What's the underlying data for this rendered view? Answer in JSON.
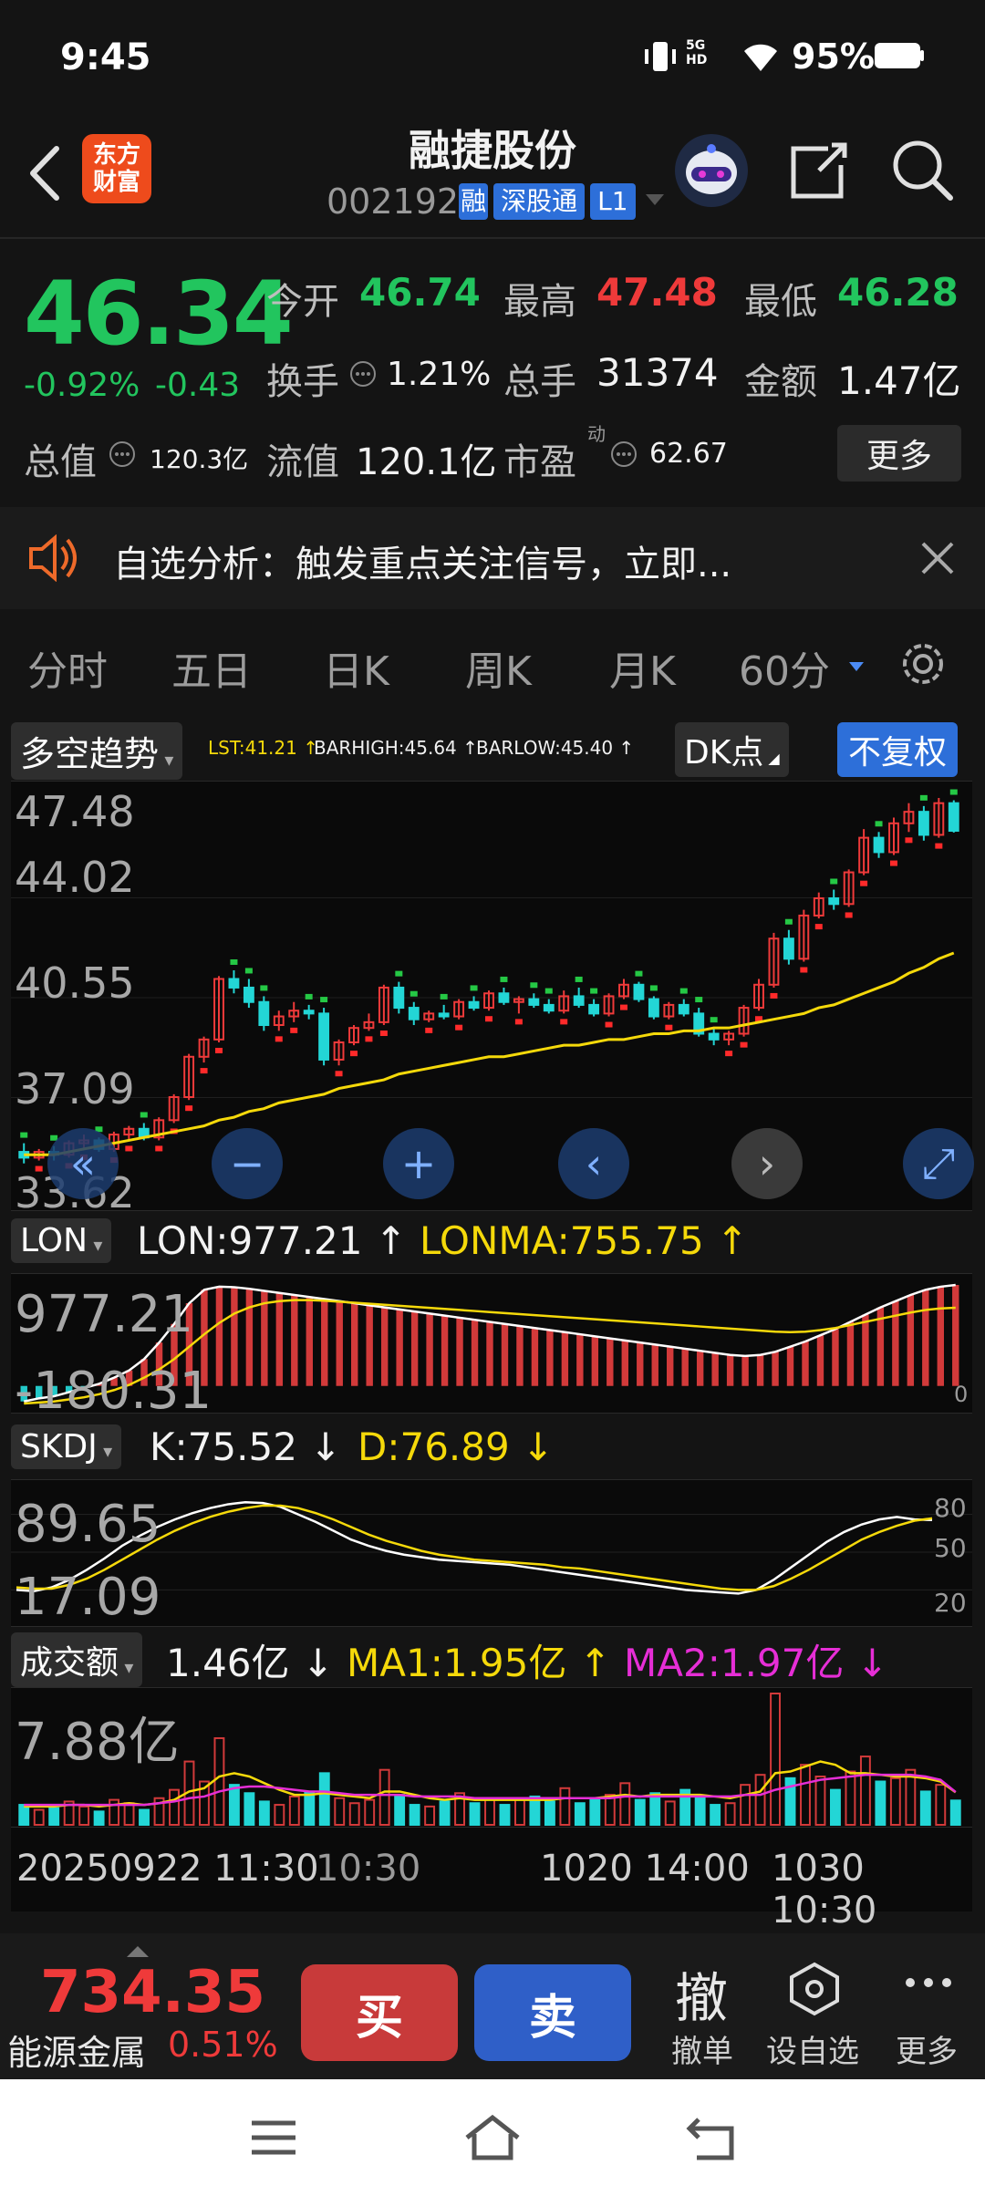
{
  "status_bar": {
    "time": "9:45",
    "network": "5G HD",
    "battery": "95%"
  },
  "header": {
    "logo_line1": "东方",
    "logo_line2": "财富",
    "stock_name": "融捷股份",
    "stock_code": "002192",
    "code_tag": "融",
    "tags": [
      "深股通",
      "L1"
    ]
  },
  "quote": {
    "price": "46.34",
    "change_pct": "-0.92%",
    "change": "-0.43",
    "open_label": "今开",
    "open": "46.74",
    "high_label": "最高",
    "high": "47.48",
    "low_label": "最低",
    "low": "46.28",
    "turnover_label": "换手",
    "turnover": "1.21%",
    "volume_label": "总手",
    "volume": "31374",
    "amount_label": "金额",
    "amount": "1.47亿",
    "mktcap_label": "总值",
    "mktcap": "120.3亿",
    "float_label": "流值",
    "float_cap": "120.1亿",
    "pe_label": "市盈",
    "pe_sup": "动",
    "pe": "62.67",
    "more_label": "更多"
  },
  "alert": {
    "text": "自选分析：触发重点关注信号，立即..."
  },
  "tabs": [
    "分时",
    "五日",
    "日K",
    "周K",
    "月K",
    "60分"
  ],
  "main_chart": {
    "indicator": "多空趋势",
    "lst": "LST:41.21 ↑",
    "barhigh": "BARHIGH:45.64 ↑",
    "barlow": "BARLOW:45.40 ↑",
    "dk_label": "DK点",
    "fq_label": "不复权",
    "yticks": [
      "47.48",
      "44.02",
      "40.55",
      "37.09",
      "33.62"
    ]
  },
  "lon_panel": {
    "name": "LON",
    "lon": "LON:977.21 ↑",
    "lonma": "LONMA:755.75 ↑",
    "ytop": "977.21",
    "ybottom": "-180.31",
    "right_label": "0"
  },
  "skdj_panel": {
    "name": "SKDJ",
    "k": "K:75.52 ↓",
    "d": "D:76.89 ↓",
    "ytop": "89.65",
    "ybottom": "17.09",
    "r80": "80",
    "r50": "50",
    "r20": "20"
  },
  "vol_panel": {
    "name": "成交额",
    "val": "1.46亿 ↓",
    "ma1": "MA1:1.95亿 ↑",
    "ma2": "MA2:1.97亿 ↓",
    "ytop": "7.88亿"
  },
  "x_axis": {
    "left": "20250922 11:30",
    "left2": "10:30",
    "mid": "1020 14:00",
    "right": "1030 10:30"
  },
  "bottom_bar": {
    "index_value": "734.35",
    "index_name": "能源金属",
    "index_change": "0.51%",
    "buy": "买",
    "sell": "卖",
    "cancel_icon": "撤",
    "cancel": "撤单",
    "watch": "设自选",
    "more": "更多"
  },
  "chart_data": {
    "type": "candlestick",
    "ylim": [
      33.62,
      47.48
    ],
    "candles": [
      [
        35.2,
        35.5,
        34.8,
        35.0
      ],
      [
        35.0,
        35.3,
        34.9,
        35.2
      ],
      [
        35.2,
        35.4,
        34.9,
        35.1
      ],
      [
        35.1,
        35.6,
        35.0,
        35.5
      ],
      [
        35.5,
        35.8,
        35.3,
        35.6
      ],
      [
        35.6,
        35.7,
        35.2,
        35.3
      ],
      [
        35.3,
        35.9,
        35.2,
        35.8
      ],
      [
        35.8,
        36.1,
        35.6,
        36.0
      ],
      [
        36.0,
        36.2,
        35.6,
        35.7
      ],
      [
        35.7,
        36.4,
        35.6,
        36.3
      ],
      [
        36.3,
        37.2,
        36.2,
        37.1
      ],
      [
        37.1,
        38.6,
        37.0,
        38.5
      ],
      [
        38.5,
        39.2,
        38.3,
        39.1
      ],
      [
        39.1,
        41.3,
        39.0,
        41.2
      ],
      [
        41.2,
        41.5,
        40.7,
        40.9
      ],
      [
        40.9,
        41.2,
        40.2,
        40.4
      ],
      [
        40.4,
        40.6,
        39.4,
        39.6
      ],
      [
        39.6,
        40.1,
        39.4,
        39.9
      ],
      [
        39.9,
        40.4,
        39.7,
        40.1
      ],
      [
        40.1,
        40.3,
        39.8,
        40.0
      ],
      [
        40.0,
        40.2,
        38.2,
        38.4
      ],
      [
        38.4,
        39.1,
        38.2,
        39.0
      ],
      [
        39.0,
        39.6,
        38.9,
        39.5
      ],
      [
        39.5,
        40.0,
        39.4,
        39.7
      ],
      [
        39.7,
        41.0,
        39.6,
        40.9
      ],
      [
        40.9,
        41.1,
        40.0,
        40.2
      ],
      [
        40.2,
        40.4,
        39.6,
        39.8
      ],
      [
        39.8,
        40.1,
        39.7,
        40.0
      ],
      [
        40.0,
        40.3,
        39.8,
        39.9
      ],
      [
        39.9,
        40.5,
        39.8,
        40.4
      ],
      [
        40.4,
        40.6,
        40.1,
        40.2
      ],
      [
        40.2,
        40.8,
        40.1,
        40.7
      ],
      [
        40.7,
        40.9,
        40.3,
        40.4
      ],
      [
        40.4,
        40.6,
        40.0,
        40.5
      ],
      [
        40.5,
        40.7,
        40.2,
        40.3
      ],
      [
        40.3,
        40.5,
        40.0,
        40.1
      ],
      [
        40.1,
        40.8,
        40.0,
        40.6
      ],
      [
        40.6,
        40.9,
        40.2,
        40.3
      ],
      [
        40.3,
        40.5,
        39.9,
        40.0
      ],
      [
        40.0,
        40.7,
        39.9,
        40.6
      ],
      [
        40.6,
        41.2,
        40.5,
        41.0
      ],
      [
        41.0,
        41.1,
        40.4,
        40.5
      ],
      [
        40.5,
        40.6,
        39.8,
        39.9
      ],
      [
        39.9,
        40.4,
        39.8,
        40.3
      ],
      [
        40.3,
        40.5,
        39.9,
        40.0
      ],
      [
        40.0,
        40.2,
        39.2,
        39.3
      ],
      [
        39.3,
        39.5,
        38.9,
        39.1
      ],
      [
        39.1,
        39.4,
        38.9,
        39.3
      ],
      [
        39.3,
        40.3,
        39.2,
        40.2
      ],
      [
        40.2,
        41.2,
        40.1,
        41.0
      ],
      [
        41.0,
        42.8,
        40.9,
        42.6
      ],
      [
        42.6,
        42.9,
        41.7,
        41.9
      ],
      [
        41.9,
        43.6,
        41.8,
        43.4
      ],
      [
        43.4,
        44.2,
        43.3,
        44.0
      ],
      [
        44.0,
        44.3,
        43.6,
        43.8
      ],
      [
        43.8,
        45.0,
        43.7,
        44.9
      ],
      [
        44.9,
        46.4,
        44.8,
        46.1
      ],
      [
        46.1,
        46.3,
        45.4,
        45.6
      ],
      [
        45.6,
        46.8,
        45.5,
        46.6
      ],
      [
        46.6,
        47.3,
        46.3,
        47.0
      ],
      [
        47.0,
        47.2,
        46.0,
        46.2
      ],
      [
        46.2,
        47.48,
        46.1,
        47.3
      ],
      [
        47.3,
        47.4,
        46.28,
        46.34
      ]
    ],
    "ma": [
      35.1,
      35.1,
      35.1,
      35.2,
      35.3,
      35.4,
      35.5,
      35.6,
      35.7,
      35.8,
      35.9,
      36.0,
      36.1,
      36.3,
      36.4,
      36.6,
      36.7,
      36.9,
      37.0,
      37.1,
      37.2,
      37.4,
      37.5,
      37.6,
      37.7,
      37.9,
      38.0,
      38.1,
      38.2,
      38.3,
      38.4,
      38.5,
      38.5,
      38.6,
      38.7,
      38.8,
      38.9,
      38.9,
      39.0,
      39.1,
      39.1,
      39.2,
      39.3,
      39.3,
      39.4,
      39.4,
      39.5,
      39.5,
      39.6,
      39.7,
      39.8,
      39.9,
      40.0,
      40.2,
      40.3,
      40.5,
      40.7,
      40.9,
      41.1,
      41.4,
      41.6,
      41.9,
      42.1
    ],
    "lon": [
      -150,
      -120,
      -100,
      -60,
      -20,
      20,
      80,
      150,
      260,
      420,
      600,
      800,
      930,
      960,
      955,
      940,
      920,
      900,
      880,
      860,
      840,
      820,
      800,
      780,
      760,
      740,
      720,
      700,
      680,
      660,
      640,
      620,
      600,
      580,
      560,
      540,
      520,
      500,
      480,
      460,
      440,
      420,
      400,
      380,
      360,
      340,
      320,
      300,
      290,
      300,
      330,
      380,
      430,
      490,
      550,
      620,
      690,
      760,
      820,
      880,
      930,
      960,
      977
    ],
    "lonma": [
      -170,
      -160,
      -150,
      -130,
      -110,
      -80,
      -40,
      10,
      80,
      160,
      260,
      380,
      500,
      610,
      700,
      760,
      800,
      820,
      830,
      830,
      825,
      815,
      805,
      795,
      785,
      775,
      765,
      755,
      745,
      735,
      725,
      715,
      705,
      695,
      685,
      675,
      665,
      655,
      645,
      635,
      625,
      615,
      605,
      595,
      585,
      575,
      565,
      555,
      545,
      535,
      525,
      520,
      525,
      540,
      560,
      590,
      620,
      650,
      680,
      710,
      735,
      750,
      756
    ],
    "skdj_k": [
      20,
      19,
      22,
      28,
      36,
      45,
      55,
      63,
      70,
      76,
      81,
      85,
      88,
      89.65,
      89,
      86,
      80,
      74,
      67,
      60,
      55,
      51,
      48,
      46,
      44,
      43,
      42,
      41,
      40,
      38,
      36,
      34,
      32,
      30,
      28,
      26,
      24,
      22,
      20,
      19,
      18,
      17.09,
      20,
      28,
      38,
      48,
      58,
      66,
      72,
      76,
      78,
      76,
      75.52
    ],
    "skdj_d": [
      22,
      21,
      21,
      24,
      29,
      36,
      44,
      52,
      60,
      67,
      73,
      78,
      82,
      85,
      87,
      87,
      85,
      81,
      76,
      70,
      64,
      59,
      55,
      51,
      48,
      46,
      44,
      43,
      42,
      41,
      40,
      38,
      37,
      35,
      33,
      31,
      29,
      27,
      25,
      23,
      21,
      20,
      20,
      23,
      29,
      36,
      44,
      52,
      60,
      66,
      71,
      75,
      76.89
    ],
    "volume": [
      1.2,
      0.9,
      1.0,
      1.4,
      1.1,
      0.8,
      1.5,
      1.3,
      0.9,
      1.6,
      2.1,
      3.8,
      2.6,
      5.2,
      2.4,
      1.9,
      1.4,
      1.2,
      1.7,
      2.0,
      3.1,
      1.6,
      1.3,
      1.5,
      3.3,
      1.8,
      1.2,
      1.1,
      1.4,
      1.9,
      1.3,
      1.6,
      1.2,
      1.5,
      1.7,
      1.4,
      2.2,
      1.3,
      1.6,
      1.8,
      2.5,
      1.5,
      1.9,
      1.4,
      2.1,
      1.7,
      1.2,
      1.3,
      2.4,
      3.0,
      7.88,
      2.8,
      3.6,
      2.9,
      2.1,
      3.2,
      4.1,
      2.6,
      2.8,
      3.3,
      2.0,
      2.4,
      1.46
    ],
    "vol_ma1": [
      1.1,
      1.1,
      1.1,
      1.2,
      1.2,
      1.1,
      1.2,
      1.3,
      1.2,
      1.3,
      1.5,
      2.0,
      2.2,
      2.9,
      3.1,
      2.9,
      2.5,
      2.1,
      1.8,
      1.8,
      1.9,
      1.8,
      1.7,
      1.6,
      2.0,
      2.0,
      1.8,
      1.6,
      1.5,
      1.6,
      1.5,
      1.5,
      1.5,
      1.5,
      1.5,
      1.5,
      1.6,
      1.6,
      1.6,
      1.7,
      1.8,
      1.7,
      1.8,
      1.8,
      1.8,
      1.8,
      1.7,
      1.6,
      1.8,
      2.0,
      3.1,
      3.2,
      3.5,
      3.8,
      3.6,
      3.1,
      3.1,
      3.0,
      2.9,
      2.9,
      2.8,
      2.6,
      1.95
    ],
    "vol_ma2": [
      1.2,
      1.2,
      1.2,
      1.2,
      1.2,
      1.2,
      1.2,
      1.2,
      1.2,
      1.3,
      1.4,
      1.6,
      1.7,
      2.0,
      2.2,
      2.3,
      2.3,
      2.2,
      2.1,
      2.0,
      2.0,
      1.9,
      1.8,
      1.8,
      1.8,
      1.8,
      1.7,
      1.7,
      1.7,
      1.7,
      1.6,
      1.6,
      1.6,
      1.6,
      1.6,
      1.6,
      1.6,
      1.6,
      1.6,
      1.6,
      1.7,
      1.7,
      1.7,
      1.7,
      1.7,
      1.7,
      1.7,
      1.7,
      1.8,
      1.8,
      2.1,
      2.3,
      2.5,
      2.7,
      2.8,
      2.9,
      3.0,
      3.0,
      3.0,
      3.0,
      2.9,
      2.7,
      1.97
    ]
  }
}
